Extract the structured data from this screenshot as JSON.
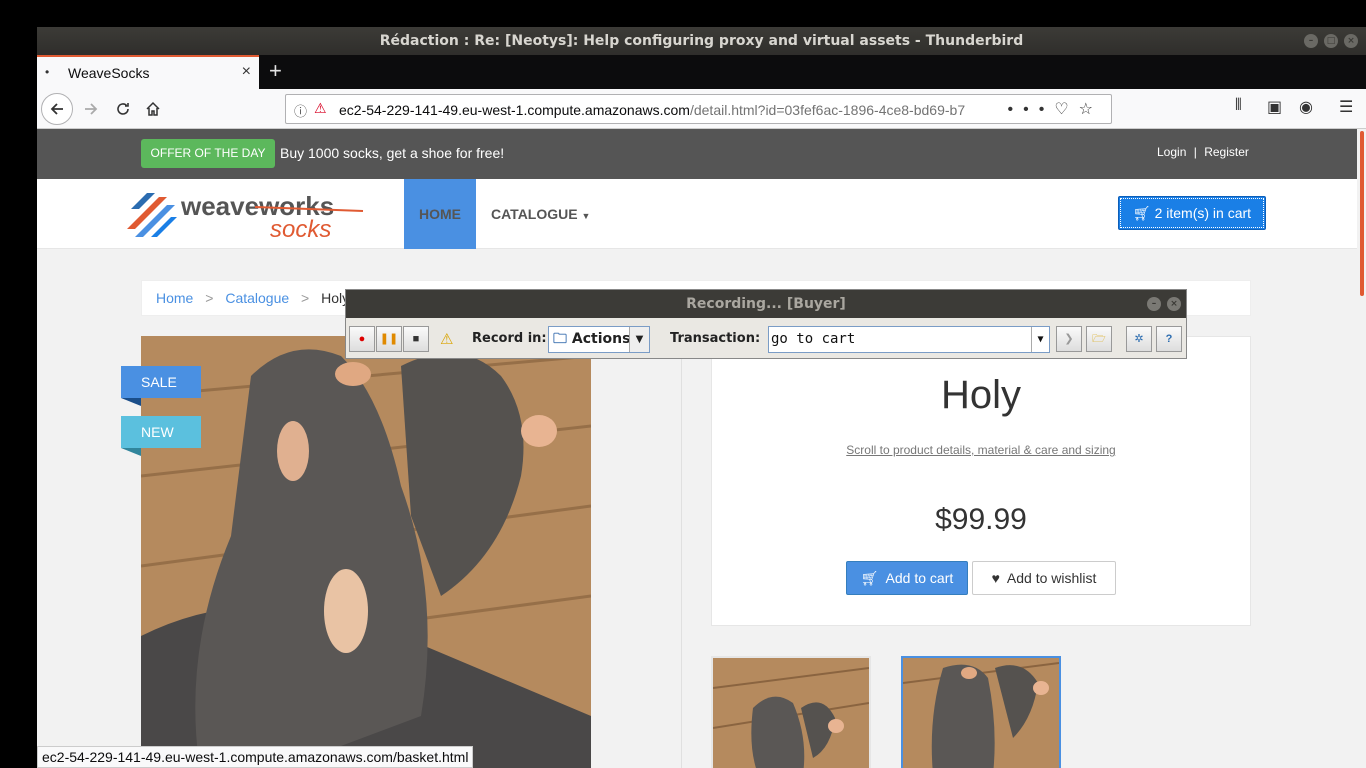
{
  "window": {
    "title": "Rédaction : Re: [Neotys]: Help configuring proxy and virtual assets - Thunderbird"
  },
  "browser": {
    "tab": {
      "title": "WeaveSocks",
      "dot": "•",
      "close": "×"
    },
    "new_tab": "+",
    "url": {
      "host": "ec2-54-229-141-49.eu-west-1.compute.amazonaws.com",
      "path": "/detail.html?id=03fef6ac-1896-4ce8-bd69-b7"
    },
    "status_url": "ec2-54-229-141-49.eu-west-1.compute.amazonaws.com/basket.html"
  },
  "site": {
    "offer_badge": "OFFER OF THE DAY",
    "offer_text": "Buy 1000 socks, get a shoe for free!",
    "login": "Login",
    "auth_sep": "|",
    "register": "Register",
    "logo_line1": "weaveworks",
    "logo_line2": "socks",
    "nav_home": "HOME",
    "nav_catalogue": "CATALOGUE",
    "cart_button": "2 item(s) in cart",
    "breadcrumb": {
      "home": "Home",
      "catalogue": "Catalogue",
      "current": "Holy",
      "sep": ">"
    },
    "ribbon_sale": "SALE",
    "ribbon_new": "NEW",
    "product": {
      "name": "Holy",
      "scroll_link": "Scroll to product details, material & care and sizing",
      "price": "$99.99",
      "add_to_cart": "Add to cart",
      "add_to_wishlist": "Add to wishlist"
    }
  },
  "recorder": {
    "title": "Recording... [Buyer]",
    "record_in_label": "Record in:",
    "record_in_value": "Actions",
    "transaction_label": "Transaction:",
    "transaction_value": "go to cart"
  },
  "icons": {
    "back": "arrow-left-icon",
    "forward": "arrow-right-icon",
    "reload": "reload-icon",
    "home": "home-icon",
    "cart": "cart-icon",
    "heart": "heart-icon"
  },
  "colors": {
    "accent_blue": "#4a90e2",
    "offer_green": "#5cb85c",
    "topbar": "#555555",
    "tab_accent": "#e05a32"
  }
}
